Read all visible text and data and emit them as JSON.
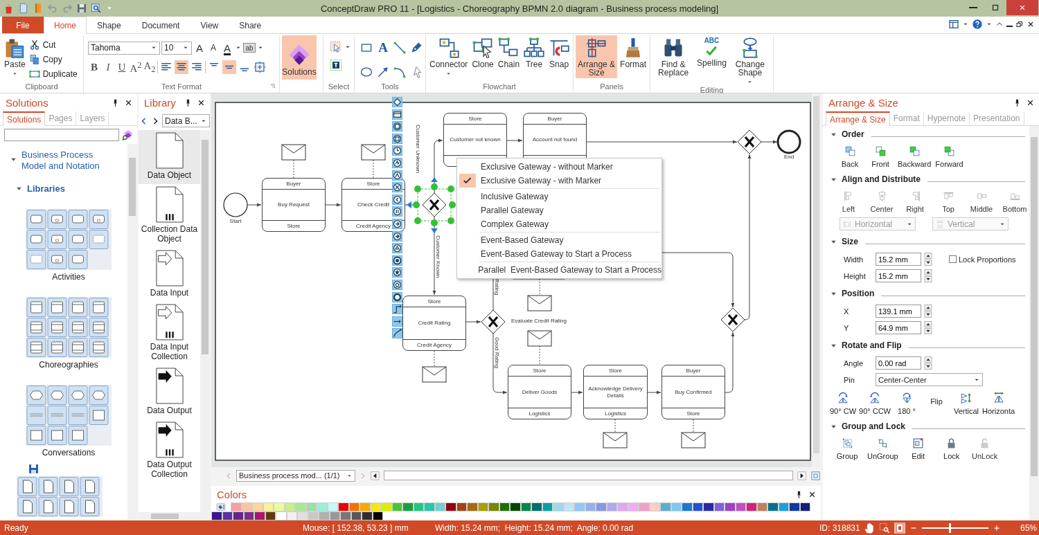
{
  "window": {
    "title": "ConceptDraw PRO 11 - [Logistics - Choreography BPMN 2.0 diagram - Business process modeling]"
  },
  "ribbon_tabs": [
    {
      "label": "File",
      "kind": "file",
      "selected": false
    },
    {
      "label": "Home",
      "kind": "tab",
      "selected": true
    },
    {
      "label": "Shape",
      "kind": "tab",
      "selected": false
    },
    {
      "label": "Document",
      "kind": "tab",
      "selected": false
    },
    {
      "label": "View",
      "kind": "tab",
      "selected": false
    },
    {
      "label": "Share",
      "kind": "tab",
      "selected": false
    }
  ],
  "clipboard": {
    "label": "Clipboard",
    "paste": "Paste",
    "actions": [
      "Cut",
      "Copy",
      "Duplicate"
    ]
  },
  "text_format": {
    "label": "Text Format",
    "font": "Tahoma",
    "size": "10",
    "size_buttons": [
      "A",
      "A"
    ],
    "font_color": "A",
    "highlight": "ab",
    "styles": [
      "B",
      "I",
      "U",
      "A$^{2}$",
      "A$_{2}$"
    ],
    "align": [
      {
        "kind": "left",
        "selected": false
      },
      {
        "kind": "center",
        "selected": true
      },
      {
        "kind": "right",
        "selected": false
      }
    ],
    "valign": [
      {
        "kind": "top",
        "selected": false
      },
      {
        "kind": "middle",
        "selected": true
      },
      {
        "kind": "bottom",
        "selected": false
      }
    ]
  },
  "solutions_button": {
    "label": "Solutions",
    "selected": true
  },
  "select_group": {
    "label": "Select"
  },
  "tools_group": {
    "label": "Tools",
    "text_tool": "A"
  },
  "ribbon_groups": [
    {
      "label": "Flowchart",
      "buttons": [
        {
          "label": "Connector",
          "dropdown": true,
          "selected": false
        },
        {
          "label": "Clone",
          "dropdown": false,
          "selected": false
        },
        {
          "label": "Chain",
          "dropdown": false,
          "selected": false
        },
        {
          "label": "Tree",
          "dropdown": false,
          "selected": false
        },
        {
          "label": "Snap",
          "dropdown": false,
          "selected": false
        }
      ]
    },
    {
      "label": "Panels",
      "buttons": [
        {
          "label": "Arrange & Size",
          "dropdown": false,
          "selected": true
        },
        {
          "label": "Format",
          "dropdown": false,
          "selected": false
        }
      ]
    },
    {
      "label": "Editing",
      "buttons": [
        {
          "label": "Find & Replace",
          "dropdown": false,
          "selected": false
        },
        {
          "label": "Spelling",
          "icon_text": "ABC",
          "dropdown": false,
          "selected": false
        },
        {
          "label": "Change Shape",
          "dropdown": true,
          "selected": false
        }
      ]
    }
  ],
  "solutions_panel": {
    "title": "Solutions",
    "tabs": [
      {
        "label": "Solutions",
        "selected": true
      },
      {
        "label": "Pages",
        "selected": false
      },
      {
        "label": "Layers",
        "selected": false
      }
    ],
    "tree": [
      {
        "label": "Business Process Model and Notation",
        "expanded": true,
        "children": [
          {
            "label": "Libraries",
            "expanded": true
          }
        ]
      }
    ],
    "libraries": [
      "Activities",
      "Choreographies",
      "Conversations"
    ]
  },
  "library_panel": {
    "title": "Library",
    "dropdown": "Data B...",
    "items": [
      {
        "label": "Data Object",
        "selected": true
      },
      {
        "label": "Collection Data Object",
        "selected": false
      },
      {
        "label": "Data Input",
        "selected": false
      },
      {
        "label": "Data Input Collection",
        "selected": false
      },
      {
        "label": "Data Output",
        "selected": false
      },
      {
        "label": "Data Output Collection",
        "selected": false
      }
    ]
  },
  "diagram": {
    "events": [
      {
        "kind": "start",
        "label": "Start"
      },
      {
        "kind": "end",
        "label": "End"
      }
    ],
    "tasks": [
      {
        "top": "Buyer",
        "name": "Buy Request",
        "bottom": "Store"
      },
      {
        "top": "Store",
        "name": "Check Credit",
        "bottom": "Credit Agency"
      },
      {
        "top": "Store",
        "name": "Customer not known"
      },
      {
        "top": "Buyer",
        "name": "Account not found"
      },
      {
        "top": "Store",
        "name": "Credit Rating",
        "bottom": "Credit Agency"
      },
      {
        "top": "Store",
        "name": "Deliver Goods",
        "bottom": "Logistics"
      },
      {
        "top": "Store",
        "name": "Acknowledge Delivery Details",
        "bottom": "Logistics"
      },
      {
        "top": "Buyer",
        "name": "Buy Confirmed",
        "bottom": "Store"
      }
    ],
    "flow_labels": [
      "Customer Unknown",
      "Customer Known",
      "Rating",
      "Good Rating"
    ],
    "note": "Evaluate Credit Rating"
  },
  "context_menu": {
    "sections": [
      {
        "items": [
          {
            "label": "Exclusive Gateway - without Marker",
            "checked": false
          },
          {
            "label": "Exclusive Gateway - with Marker",
            "checked": true
          }
        ]
      },
      {
        "items": [
          {
            "label": "Inclusive Gateway",
            "checked": false
          },
          {
            "label": "Parallel Gateway",
            "checked": false
          },
          {
            "label": "Complex Gateway",
            "checked": false
          }
        ]
      },
      {
        "items": [
          {
            "label": "Event-Based Gateway",
            "checked": false
          },
          {
            "label": "Event-Based Gateway to Start a Process",
            "checked": false
          }
        ]
      },
      {
        "items": [
          {
            "label": "Parallel  Event-Based Gateway to Start a Process",
            "checked": false
          }
        ]
      }
    ]
  },
  "page_tabs": {
    "page": "Business process mod... (1/1)"
  },
  "colors_panel": {
    "title": "Colors",
    "swatches": [
      {
        "color": "#f4a0a0"
      },
      {
        "color": "#f9c4a0"
      },
      {
        "color": "#fbd79a"
      },
      {
        "color": "#f9f29a"
      },
      {
        "color": "#eef99a"
      },
      {
        "color": "#c8f08a"
      },
      {
        "color": "#a8e890"
      },
      {
        "color": "#98e0a8"
      },
      {
        "color": "#98f0d8"
      },
      {
        "color": "#c8f8f8"
      },
      {
        "color": "#ee0000"
      },
      {
        "color": "#f87000"
      },
      {
        "color": "#f8a800"
      },
      {
        "color": "#f8e800"
      },
      {
        "color": "#d8f000"
      },
      {
        "color": "#48c830"
      },
      {
        "color": "#18a040"
      },
      {
        "color": "#20c880"
      },
      {
        "color": "#20c8b0"
      },
      {
        "color": "#70d0d0"
      },
      {
        "color": "#980010"
      },
      {
        "color": "#a84010"
      },
      {
        "color": "#a86810"
      },
      {
        "color": "#a8a000"
      },
      {
        "color": "#788800"
      },
      {
        "color": "#207000"
      },
      {
        "color": "#004800"
      },
      {
        "color": "#008848"
      },
      {
        "color": "#007070"
      },
      {
        "color": "#00a0a8"
      },
      {
        "color": "#a0d8e8"
      },
      {
        "color": "#c0e4f8"
      },
      {
        "color": "#90c8f8"
      },
      {
        "color": "#98b0e8"
      },
      {
        "color": "#8898e8"
      },
      {
        "color": "#b0a8f0"
      },
      {
        "color": "#e0a8f0"
      },
      {
        "color": "#f8a8f8"
      },
      {
        "color": "#f0a0c8"
      },
      {
        "color": "#f8d0c8"
      },
      {
        "color": "#58b0d0"
      },
      {
        "color": "#80c8f8"
      },
      {
        "color": "#1878d8"
      },
      {
        "color": "#2050d8"
      },
      {
        "color": "#2828a8"
      },
      {
        "color": "#8060e0"
      },
      {
        "color": "#a040c8"
      },
      {
        "color": "#c050c0"
      },
      {
        "color": "#d82078"
      },
      {
        "color": "#c08060"
      },
      {
        "color": "#087090"
      },
      {
        "color": "#18a0e0"
      },
      {
        "color": "#1038a0"
      },
      {
        "color": "#102080"
      },
      {
        "color": "#381890"
      },
      {
        "color": "#5830a8"
      },
      {
        "color": "#602888"
      },
      {
        "color": "#783088"
      },
      {
        "color": "#a81868"
      },
      {
        "color": "#603810"
      },
      {
        "color": "#ffffff"
      },
      {
        "color": "#f0f0f0"
      },
      {
        "color": "#e0e0e0"
      },
      {
        "color": "#c8c8c8"
      },
      {
        "color": "#b0b0b0"
      },
      {
        "color": "#989898"
      },
      {
        "color": "#787878"
      },
      {
        "color": "#585858"
      },
      {
        "color": "#303030"
      },
      {
        "color": "#000000"
      }
    ]
  },
  "arrange_panel": {
    "title": "Arrange & Size",
    "tabs": [
      {
        "label": "Arrange & Size",
        "selected": true
      },
      {
        "label": "Format",
        "selected": false
      },
      {
        "label": "Hypernote",
        "selected": false
      },
      {
        "label": "Presentation",
        "selected": false
      }
    ],
    "order": {
      "title": "Order",
      "expanded": true,
      "buttons": [
        "Back",
        "Front",
        "Backward",
        "Forward"
      ]
    },
    "align": {
      "title": "Align and Distribute",
      "expanded": true,
      "buttons": [
        {
          "label": "Left",
          "disabled": true
        },
        {
          "label": "Center",
          "disabled": true
        },
        {
          "label": "Right",
          "disabled": true
        },
        {
          "label": "Top",
          "disabled": true
        },
        {
          "label": "Middle",
          "disabled": true
        },
        {
          "label": "Bottom",
          "disabled": true
        }
      ],
      "distribute": [
        {
          "label": "Horizontal",
          "disabled": true
        },
        {
          "label": "Vertical",
          "disabled": true
        }
      ]
    },
    "size": {
      "title": "Size",
      "expanded": true,
      "fields": [
        {
          "label": "Width",
          "value": "15.2 mm"
        },
        {
          "label": "Height",
          "value": "15.2 mm"
        }
      ],
      "lock": {
        "label": "Lock Proportions",
        "checked": false
      }
    },
    "position": {
      "title": "Position",
      "expanded": true,
      "fields": [
        {
          "label": "X",
          "value": "139.1 mm"
        },
        {
          "label": "Y",
          "value": "64.9 mm"
        }
      ]
    },
    "rotate": {
      "title": "Rotate and Flip",
      "expanded": true,
      "angle": {
        "label": "Angle",
        "value": "0.00 rad"
      },
      "pin": {
        "label": "Pin",
        "value": "Center-Center"
      },
      "buttons": [
        "90° CW",
        "90° CCW",
        "180 °"
      ],
      "flip_label": "Flip",
      "flip_buttons": [
        "Vertical",
        "Horizonta"
      ]
    },
    "group_lock": {
      "title": "Group and Lock",
      "expanded": true,
      "buttons": [
        {
          "label": "Group",
          "disabled": false
        },
        {
          "label": "UnGroup",
          "disabled": false
        },
        {
          "label": "Edit",
          "disabled": false
        },
        {
          "label": "Lock",
          "disabled": false
        },
        {
          "label": "UnLock",
          "disabled": true
        }
      ]
    }
  },
  "status_bar": {
    "status": "Ready",
    "mouse": "Mouse: [ 152.38, 53.23 ] mm",
    "size": "Width: 15.24 mm;  Height: 15.24 mm;  Angle: 0.00 rad",
    "id": "ID: 318831",
    "zoom": {
      "level": 0.42
    },
    "zoom_text": "65%"
  }
}
